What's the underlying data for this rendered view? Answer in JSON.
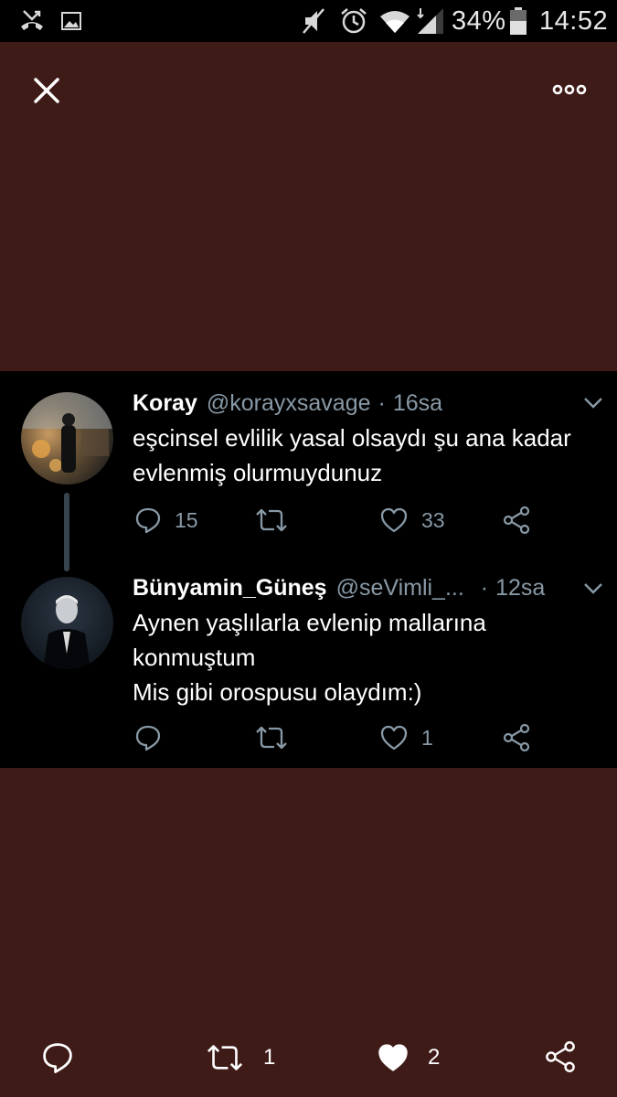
{
  "status_bar": {
    "battery_percent": "34%",
    "time": "14:52",
    "icons": [
      "missed-call-icon",
      "image-icon",
      "mute-icon",
      "alarm-icon",
      "wifi-icon",
      "signal-icon",
      "battery-icon"
    ],
    "text_color": "#e9e9e9"
  },
  "viewer": {
    "background": "#3f1b18",
    "close_icon": "close-icon",
    "more_icon": "more-icon"
  },
  "tweets": [
    {
      "name": "Koray",
      "handle": "@korayxsavage",
      "separator": "·",
      "time": "16sa",
      "lines": [
        "eşcinsel evlilik yasal olsaydı şu ana kadar",
        "evlenmiş olurmuydunuz"
      ],
      "replies": "15",
      "retweets": "",
      "likes": "33"
    },
    {
      "name": "Bünyamin_Güneş",
      "handle": "@seVimli_...",
      "separator": "·",
      "time": "12sa",
      "lines": [
        "Aynen yaşlılarla evlenip mallarına",
        "konmuştum",
        "Mis gibi orospusu olaydım:)"
      ],
      "replies": "",
      "retweets": "",
      "likes": "1"
    }
  ],
  "bottom_bar": {
    "retweets": "1",
    "likes": "2"
  },
  "colors": {
    "card_background": "#000000",
    "secondary_text": "#8899a6",
    "thread_line": "#38444d"
  }
}
